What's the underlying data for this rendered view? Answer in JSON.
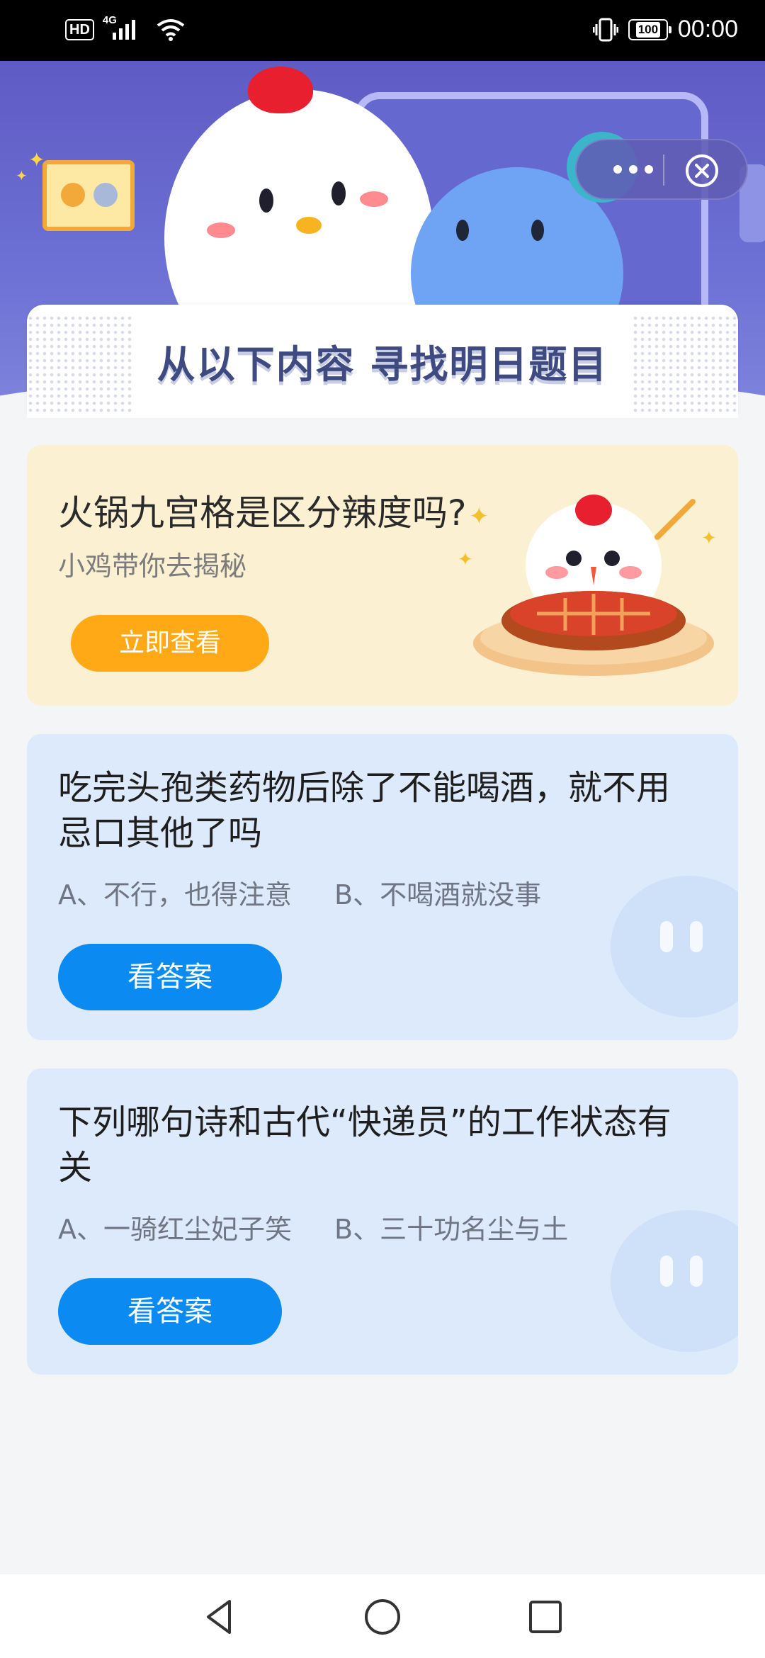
{
  "status_bar": {
    "hd": "HD",
    "network": "4G",
    "battery": "100",
    "time": "00:00"
  },
  "header": {
    "page_title": "从以下内容  寻找明日题目"
  },
  "promo_card": {
    "title": "火锅九宫格是区分辣度吗?",
    "subtitle": "小鸡带你去揭秘",
    "button_label": "立即查看"
  },
  "questions": [
    {
      "title": "吃完头孢类药物后除了不能喝酒，就不用忌口其他了吗",
      "option_a": "A、不行，也得注意",
      "option_b": "B、不喝酒就没事",
      "button_label": "看答案"
    },
    {
      "title": "下列哪句诗和古代“快递员”的工作状态有关",
      "option_a": "A、一骑红尘妃子笑",
      "option_b": "B、三十功名尘与土",
      "button_label": "看答案"
    }
  ],
  "colors": {
    "banner": "#5f5bc4",
    "promo_bg": "#fcf0d2",
    "orange_button": "#ffa917",
    "question_bg": "#ddeafb",
    "blue_button": "#0b8bf2"
  }
}
